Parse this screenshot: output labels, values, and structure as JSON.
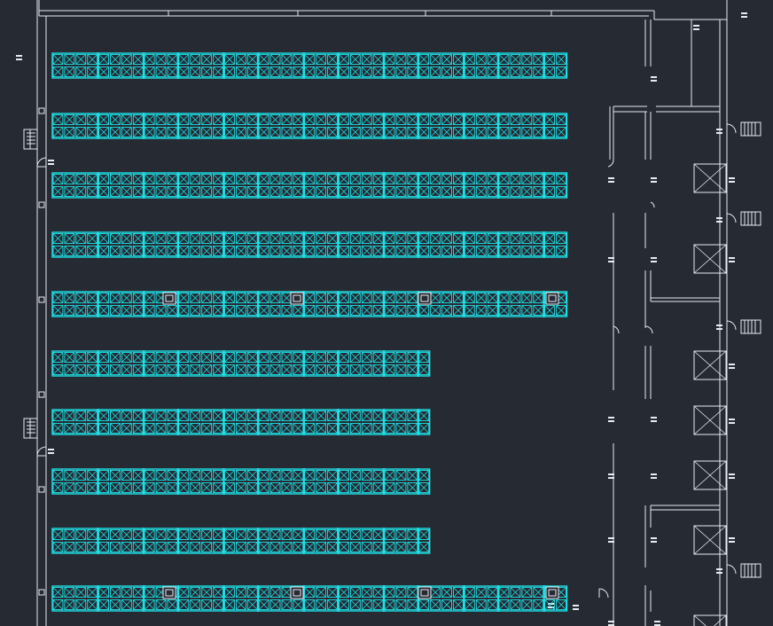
{
  "colors": {
    "background": "#262a33",
    "rack": "#1fe0e6",
    "wall": "#e8ebf0"
  },
  "racks": {
    "bay_icon": "x-braced-pallet-bay",
    "column_icon": "square-column-icon",
    "rows": [
      {
        "name": "rack-row-1",
        "bays": 45
      },
      {
        "name": "rack-row-2",
        "bays": 45
      },
      {
        "name": "rack-row-3",
        "bays": 45
      },
      {
        "name": "rack-row-4",
        "bays": 45
      },
      {
        "name": "rack-row-5",
        "bays": 45,
        "columns": 4
      },
      {
        "name": "rack-row-6",
        "bays": 33
      },
      {
        "name": "rack-row-7",
        "bays": 33
      },
      {
        "name": "rack-row-8",
        "bays": 33
      },
      {
        "name": "rack-row-9",
        "bays": 33
      },
      {
        "name": "rack-row-10",
        "bays": 45,
        "columns": 4
      }
    ]
  },
  "doors": {
    "dock_icon": "loading-dock-door-icon",
    "stair_icon": "stair-icon",
    "swing_icon": "door-swing-icon"
  }
}
